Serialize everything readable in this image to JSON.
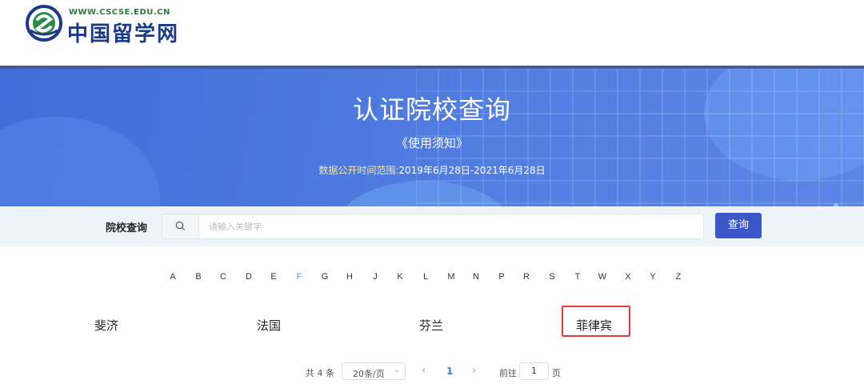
{
  "header": {
    "logo_url": "WWW.CSCSE.EDU.CN",
    "logo_name": "中国留学网"
  },
  "banner": {
    "title": "认证院校查询",
    "notice_link": "《使用须知》",
    "range_label": "数据公开时间范围:",
    "range_value": "2019年6月28日-2021年6月28日"
  },
  "search": {
    "label": "院校查询",
    "placeholder": "请输入关键字",
    "button": "查询"
  },
  "letters": [
    "A",
    "B",
    "C",
    "D",
    "E",
    "F",
    "G",
    "H",
    "J",
    "K",
    "L",
    "M",
    "N",
    "P",
    "R",
    "S",
    "T",
    "W",
    "X",
    "Y",
    "Z"
  ],
  "active_letter": "F",
  "countries": [
    "斐济",
    "法国",
    "芬兰",
    "菲律宾"
  ],
  "highlighted_country": "菲律宾",
  "pagination": {
    "total": "共 4 条",
    "page_size": "20条/页",
    "current_page": "1",
    "goto_label": "前往",
    "goto_value": "1",
    "page_suffix": "页"
  },
  "colors": {
    "banner": "#4f7be0",
    "button": "#3c58c8",
    "active_letter": "#4a8fe0",
    "highlight_border": "#e23c3c"
  }
}
